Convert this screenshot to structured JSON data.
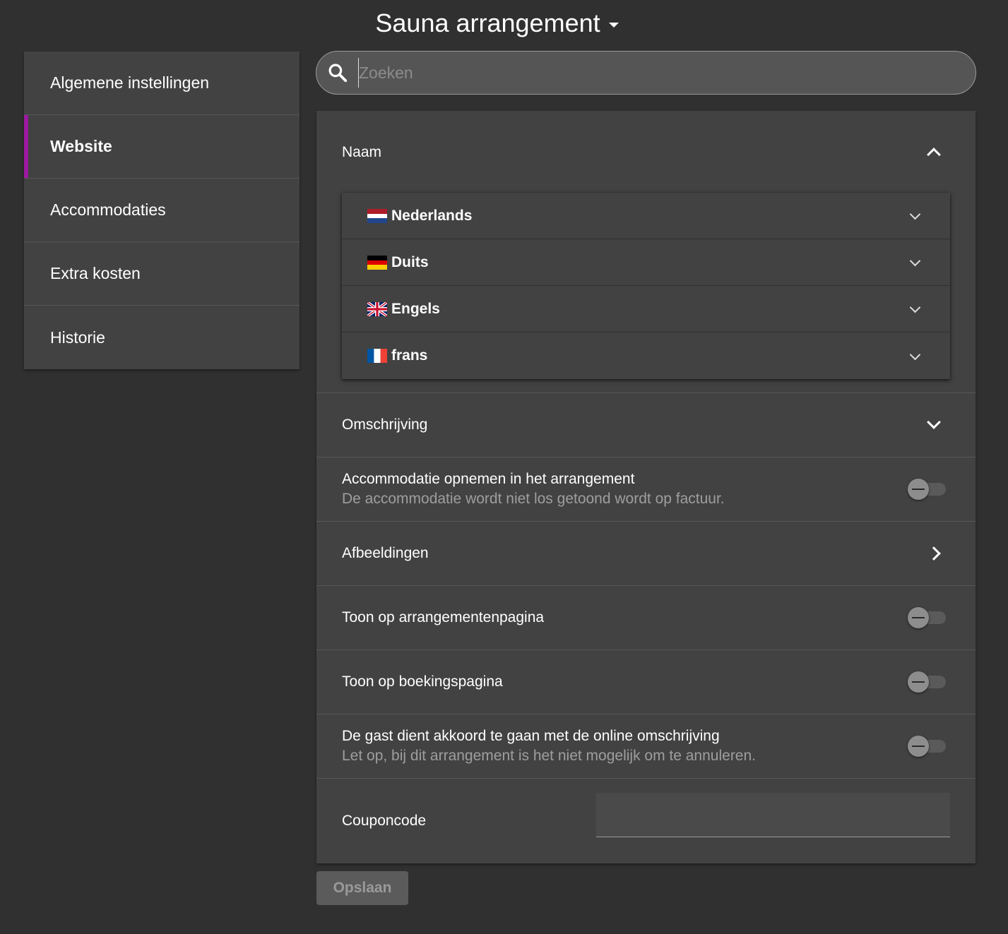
{
  "header": {
    "title": "Sauna arrangement"
  },
  "sidebar": {
    "items": [
      {
        "label": "Algemene instellingen",
        "active": false
      },
      {
        "label": "Website",
        "active": true
      },
      {
        "label": "Accommodaties",
        "active": false
      },
      {
        "label": "Extra kosten",
        "active": false
      },
      {
        "label": "Historie",
        "active": false
      }
    ]
  },
  "search": {
    "placeholder": "Zoeken",
    "value": ""
  },
  "panel": {
    "naam": {
      "label": "Naam",
      "expanded": true,
      "languages": [
        {
          "label": "Nederlands",
          "flag": "nl-flag"
        },
        {
          "label": "Duits",
          "flag": "de-flag"
        },
        {
          "label": "Engels",
          "flag": "gb-flag"
        },
        {
          "label": "frans",
          "flag": "fr-flag"
        }
      ]
    },
    "omschrijving": {
      "label": "Omschrijving",
      "expanded": false
    },
    "accommodatie": {
      "label": "Accommodatie opnemen in het arrangement",
      "sub": "De accommodatie wordt niet los getoond wordt op factuur.",
      "enabled": false
    },
    "afbeeldingen": {
      "label": "Afbeeldingen"
    },
    "toon_arrangementen": {
      "label": "Toon op arrangementenpagina",
      "enabled": false
    },
    "toon_boeking": {
      "label": "Toon op boekingspagina",
      "enabled": false
    },
    "akkoord": {
      "label": "De gast dient akkoord te gaan met de online omschrijving",
      "sub": "Let op, bij dit arrangement is het niet mogelijk om te annuleren.",
      "enabled": false
    },
    "coupon": {
      "label": "Couponcode",
      "value": ""
    }
  },
  "actions": {
    "save_label": "Opslaan"
  },
  "colors": {
    "accent": "#9c1aa0",
    "background": "#303030",
    "panel": "#424242"
  }
}
